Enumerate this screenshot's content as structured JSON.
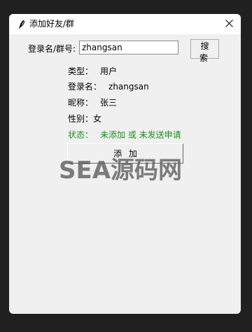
{
  "window": {
    "title": "添加好友/群",
    "icons": {
      "app": "feather-icon",
      "close": "close-icon"
    }
  },
  "search": {
    "label": "登录名/群号:",
    "value": "zhangsan",
    "button_label": "搜 索"
  },
  "result": {
    "type_label": "类型：",
    "type_value": "用户",
    "login_label": "登录名：",
    "login_value": "zhangsan",
    "nickname_label": "昵称：",
    "nickname_value": "张三",
    "gender_label": "性别：",
    "gender_value": "女",
    "status_label": "状态：",
    "status_value": "未添加 或 未发送申请"
  },
  "add_button": {
    "label": "添 加"
  },
  "watermark": "SEA源码网",
  "colors": {
    "status": "#1a8f1a",
    "window_bg": "#f0f0f0",
    "titlebar_bg": "#ffffff",
    "desktop_bg": "#202020"
  }
}
